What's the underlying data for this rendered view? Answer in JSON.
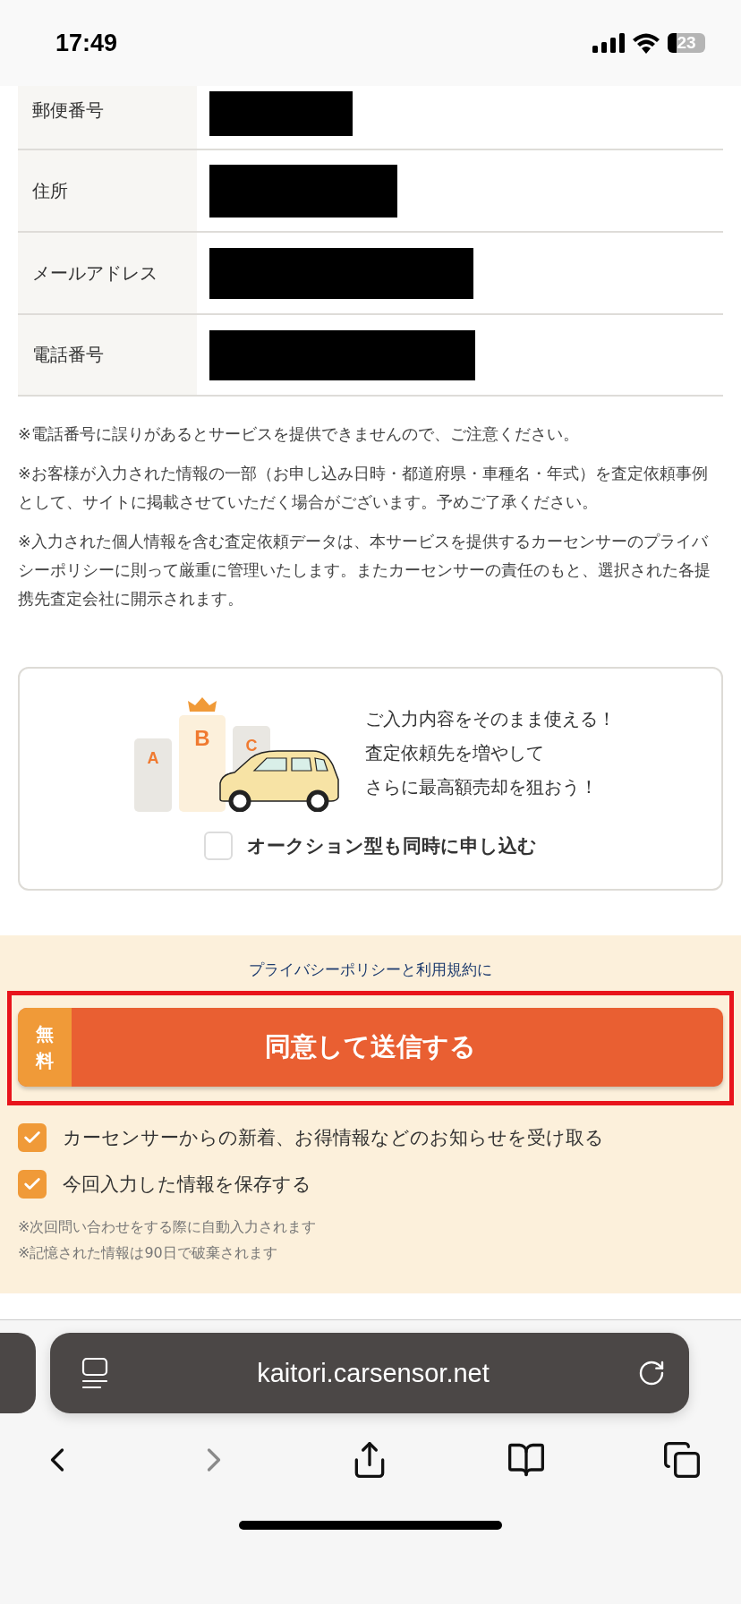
{
  "status_bar": {
    "time": "17:49",
    "battery": "23"
  },
  "table": {
    "rows": [
      {
        "label": "郵便番号",
        "value_redacted": true
      },
      {
        "label": "住所",
        "value_redacted": true
      },
      {
        "label": "メールアドレス",
        "value_redacted": true
      },
      {
        "label": "電話番号",
        "value_redacted": true
      }
    ]
  },
  "notes": [
    "※電話番号に誤りがあるとサービスを提供できませんので、ご注意ください。",
    "※お客様が入力された情報の一部（お申し込み日時・都道府県・車種名・年式）を査定依頼事例として、サイトに掲載させていただく場合がございます。予めご了承ください。",
    "※入力された個人情報を含む査定依頼データは、本サービスを提供するカーセンサーのプライバシーポリシーに則って厳重に管理いたします。またカーセンサーの責任のもと、選択された各提携先査定会社に開示されます。"
  ],
  "promo": {
    "podium": [
      "A",
      "B",
      "C"
    ],
    "lines": [
      "ご入力内容をそのまま使える！",
      "査定依頼先を増やして",
      "さらに最高額売却を狙おう！"
    ],
    "checkbox": {
      "label": "オークション型も同時に申し込む",
      "checked": false
    }
  },
  "consent": {
    "sentence": {
      "privacy_link": "プライバシーポリシー",
      "joiner": "と",
      "terms_link": "利用規約",
      "ending": "に"
    },
    "submit": {
      "badge": "無料",
      "label": "同意して送信する",
      "highlighted": true
    },
    "options": [
      {
        "label": "カーセンサーからの新着、お得情報などのお知らせを受け取る",
        "checked": true
      },
      {
        "label": "今回入力した情報を保存する",
        "checked": true
      }
    ],
    "footnotes": [
      "※次回問い合わせをする際に自動入力されます",
      "※記憶された情報は90日で破棄されます"
    ]
  },
  "browser": {
    "url": "kaitori.carsensor.net"
  }
}
